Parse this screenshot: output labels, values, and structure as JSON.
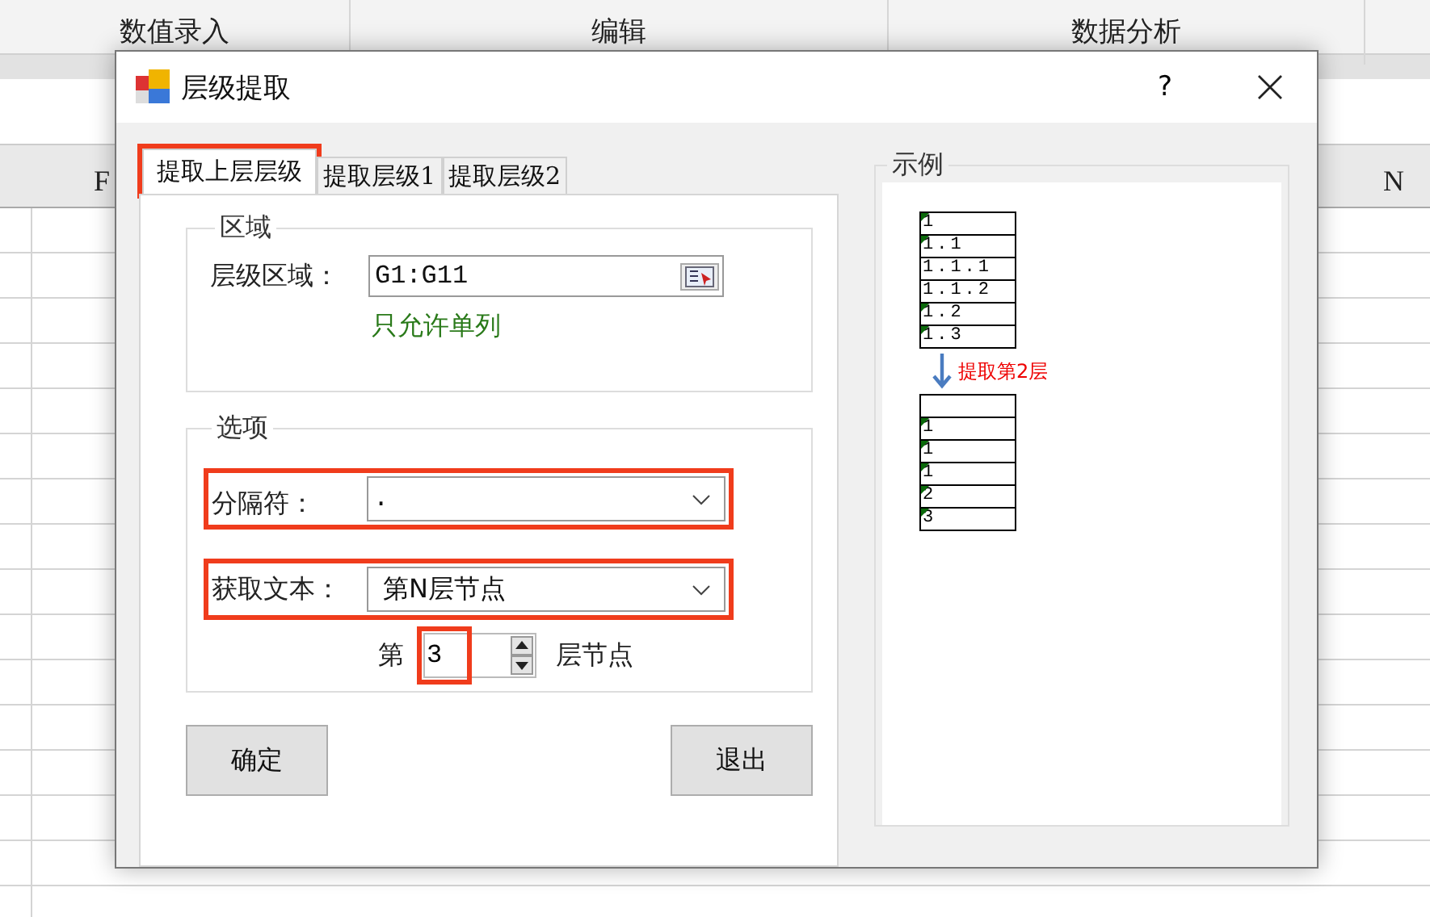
{
  "ribbon_groups": [
    "数值录入",
    "编辑",
    "数据分析"
  ],
  "column_headers": [
    "F",
    "N"
  ],
  "dialog": {
    "title": "层级提取",
    "help": "?",
    "tabs": [
      {
        "label": "提取上层层级",
        "selected": true,
        "highlighted": true
      },
      {
        "label": "提取层级1",
        "selected": false,
        "highlighted": false
      },
      {
        "label": "提取层级2",
        "selected": false,
        "highlighted": false
      }
    ],
    "region_group": {
      "title": "区域",
      "label": "层级区域：",
      "value": "G1:G11",
      "hint": "只允许单列"
    },
    "options_group": {
      "title": "选项",
      "separator": {
        "label": "分隔符：",
        "value": ".",
        "highlighted": true
      },
      "text_mode": {
        "label": "获取文本：",
        "value": "第N层节点",
        "highlighted": true
      },
      "level": {
        "prefix": "第",
        "value": "3",
        "suffix": "层节点",
        "highlighted": true
      }
    },
    "buttons": [
      "确定",
      "退出"
    ],
    "example": {
      "title": "示例",
      "before": [
        {
          "text": "1",
          "marked": true
        },
        {
          "text": "1.1",
          "marked": true
        },
        {
          "text": "1.1.1",
          "marked": false
        },
        {
          "text": "1.1.2",
          "marked": false
        },
        {
          "text": "1.2",
          "marked": true
        },
        {
          "text": "1.3",
          "marked": true
        }
      ],
      "caption": "提取第2层",
      "after": [
        {
          "kind": "blank"
        },
        {
          "kind": "text",
          "text": "1",
          "marked": true
        },
        {
          "kind": "text",
          "text": "1",
          "marked": true
        },
        {
          "kind": "text",
          "text": "1",
          "marked": true
        },
        {
          "kind": "text",
          "text": "2",
          "marked": true
        },
        {
          "kind": "text",
          "text": "3",
          "marked": true
        }
      ]
    }
  }
}
